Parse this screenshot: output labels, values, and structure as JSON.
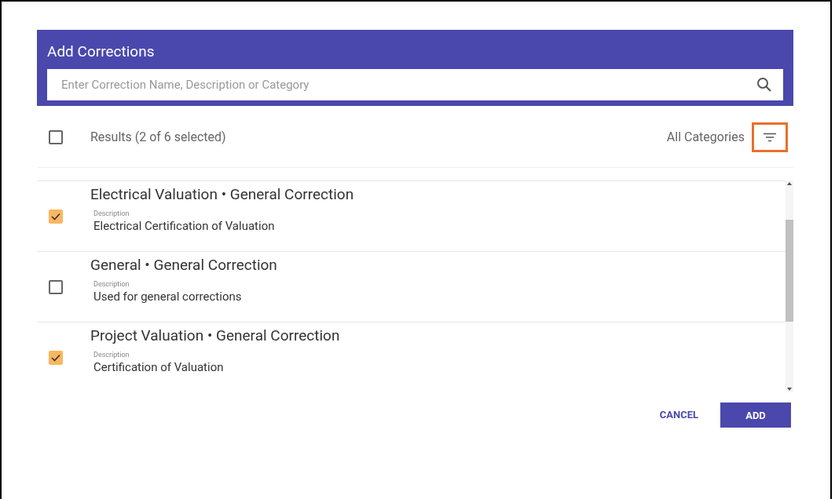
{
  "dialog": {
    "title": "Add Corrections",
    "search": {
      "placeholder": "Enter Correction Name, Description or Category"
    },
    "results": {
      "checked": false,
      "label": "Results (2 of 6 selected)",
      "filter_label": "All Categories"
    },
    "items": [
      {
        "checked": true,
        "title": "Electrical Valuation • General Correction",
        "description_label": "Description",
        "description": "Electrical Certification of Valuation"
      },
      {
        "checked": false,
        "title": "General • General Correction",
        "description_label": "Description",
        "description": "Used for general corrections"
      },
      {
        "checked": true,
        "title": "Project Valuation • General Correction",
        "description_label": "Description",
        "description": "Certification of Valuation"
      }
    ],
    "buttons": [
      "CANCEL",
      "ADD"
    ]
  }
}
